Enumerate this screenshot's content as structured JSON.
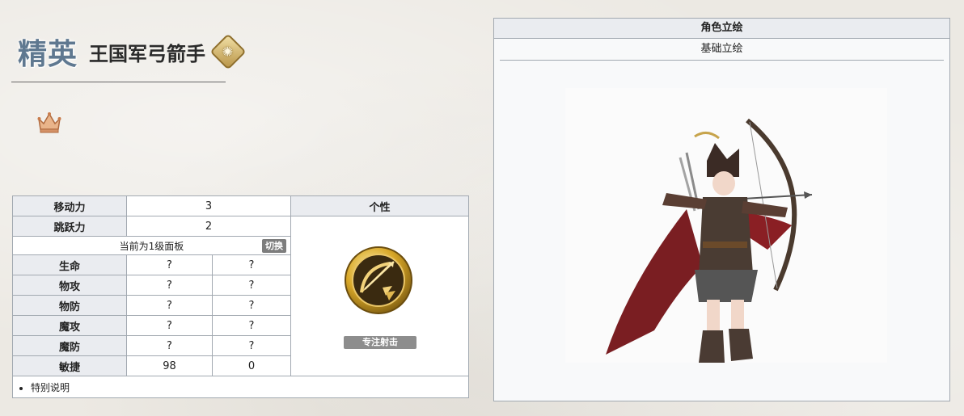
{
  "header": {
    "rarity": "精英",
    "name": "王国军弓箭手",
    "class_icon": "archer-class-emblem-icon",
    "rank_icon": "crown-icon"
  },
  "stats": {
    "move_label": "移动力",
    "move_value": "3",
    "jump_label": "跳跃力",
    "jump_value": "2",
    "trait_header": "个性",
    "level_text": "当前为1级面板",
    "switch_label": "切换",
    "rows": [
      {
        "label": "生命",
        "v1": "?",
        "v2": "?"
      },
      {
        "label": "物攻",
        "v1": "?",
        "v2": "?"
      },
      {
        "label": "物防",
        "v1": "?",
        "v2": "?"
      },
      {
        "label": "魔攻",
        "v1": "?",
        "v2": "?"
      },
      {
        "label": "魔防",
        "v1": "?",
        "v2": "?"
      },
      {
        "label": "敏捷",
        "v1": "98",
        "v2": "0"
      }
    ],
    "trait_icon": "bow-trait-icon",
    "trait_name": "专注射击",
    "note": "特别说明"
  },
  "art": {
    "header": "角色立绘",
    "tab": "基础立绘",
    "image": "archer-portrait-image"
  },
  "colors": {
    "table_header_bg": "#eaecf0",
    "border": "#a2a9b1",
    "rarity_text": "#5f7890",
    "gold": "#c9a23c"
  }
}
